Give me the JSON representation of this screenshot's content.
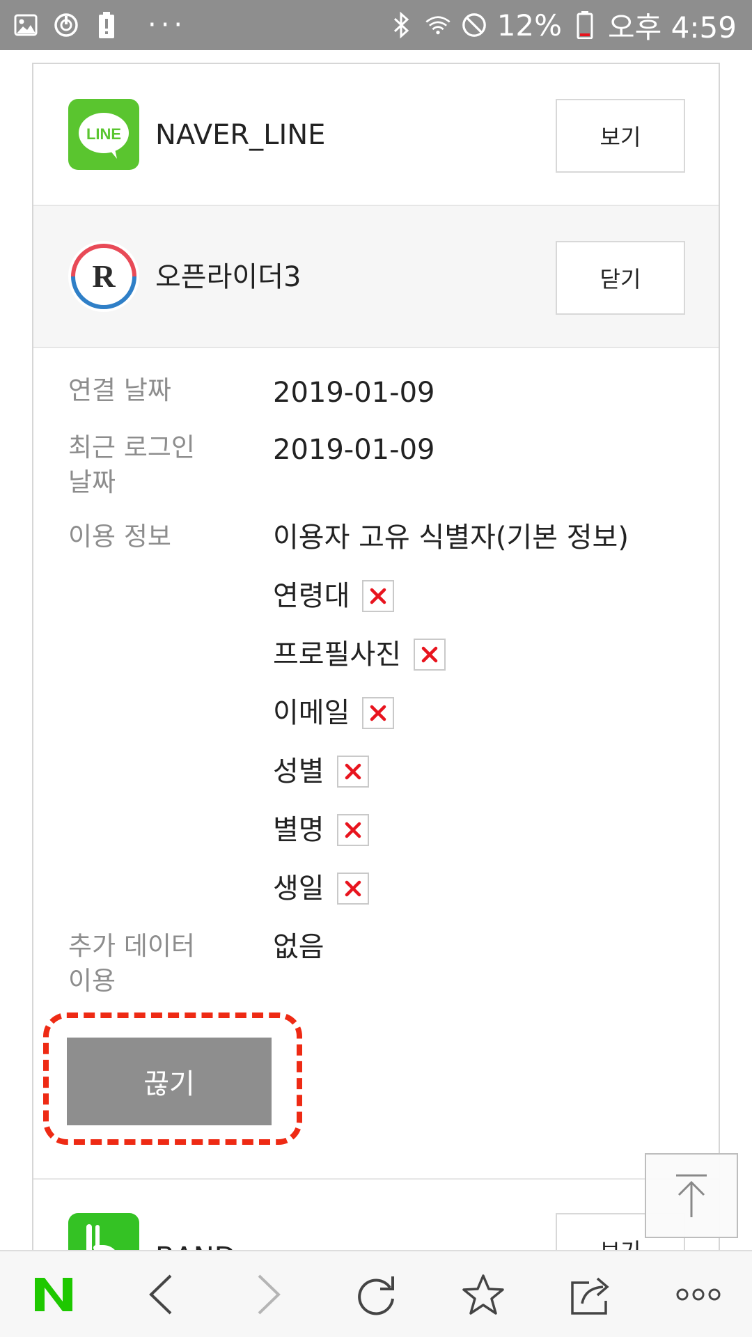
{
  "status_bar": {
    "battery_percent": "12%",
    "time": "오후 4:59",
    "left_icons": [
      "image-icon",
      "sync-icon",
      "battery-alert-icon",
      "more-dots-icon"
    ],
    "right_icons": [
      "bluetooth-icon",
      "wifi-icon",
      "do-not-disturb-icon",
      "battery-icon"
    ]
  },
  "apps": [
    {
      "name": "NAVER_LINE",
      "button": "보기",
      "icon": "line-icon",
      "icon_text": "LINE",
      "color": "#5ac52f"
    },
    {
      "name": "오픈라이더3",
      "button": "닫기",
      "icon": "openrider-icon",
      "icon_text": "R"
    },
    {
      "name": "BAND",
      "button": "보기",
      "icon": "band-icon",
      "color": "#34c224"
    }
  ],
  "details": {
    "connect_date_label": "연결 날짜",
    "connect_date": "2019-01-09",
    "recent_login_label_line1": "최근 로그인",
    "recent_login_label_line2": "날짜",
    "recent_login": "2019-01-09",
    "usage_label": "이용 정보",
    "usage_main": "이용자 고유 식별자(기본 정보)",
    "permissions": [
      "연령대",
      "프로필사진",
      "이메일",
      "성별",
      "별명",
      "생일"
    ],
    "extra_label_line1": "추가 데이터",
    "extra_label_line2": "이용",
    "extra_value": "없음"
  },
  "disconnect_label": "끊기",
  "colors": {
    "highlight": "#ee2a14",
    "x_mark": "#e8141e",
    "naver_green": "#1ec800",
    "button_gray": "#8e8e8e"
  }
}
